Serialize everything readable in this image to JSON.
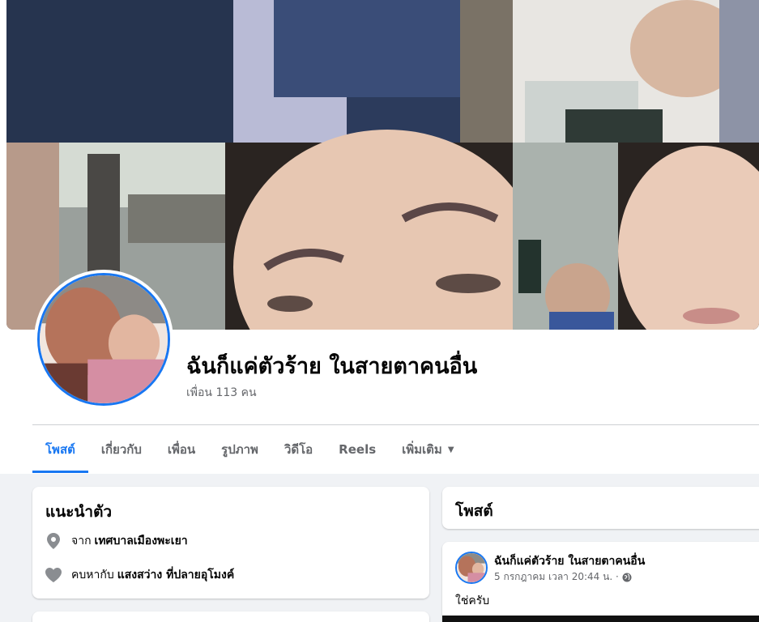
{
  "profile": {
    "name": "ฉันก็แค่ตัวร้าย ในสายตาคนอื่น",
    "friends": "เพื่อน 113 คน"
  },
  "tabs": [
    {
      "label": "โพสต์",
      "active": true
    },
    {
      "label": "เกี่ยวกับ",
      "active": false
    },
    {
      "label": "เพื่อน",
      "active": false
    },
    {
      "label": "รูปภาพ",
      "active": false
    },
    {
      "label": "วิดีโอ",
      "active": false
    },
    {
      "label": "Reels",
      "active": false
    },
    {
      "label": "เพิ่มเติม",
      "active": false
    }
  ],
  "intro": {
    "title": "แนะนำตัว",
    "location_prefix": "จาก",
    "location_value": "เทศบาลเมืองพะเยา",
    "relationship_prefix": "คบหากับ",
    "relationship_value": "แสงสว่าง ที่ปลายอุโมงค์"
  },
  "posts_section": {
    "title": "โพสต์"
  },
  "post": {
    "author": "ฉันก็แค่ตัวร้าย ในสายตาคนอื่น",
    "date": "5 กรกฎาคม เวลา 20:44 น. ·",
    "text": "ใช่ครับ"
  },
  "colors": {
    "accent": "#1877f2",
    "background": "#f0f2f5",
    "secondary_text": "#65676b"
  },
  "icons": {
    "location": "location-pin-icon",
    "relationship": "heart-icon",
    "privacy": "globe-icon",
    "more": "caret-down-icon"
  }
}
